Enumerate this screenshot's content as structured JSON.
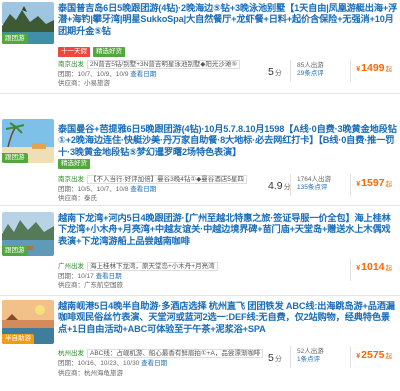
{
  "colors": {
    "title_link": "#1a6db8",
    "price": "#ff6600",
    "tag_red": "#e94a3c",
    "tag_green": "#52a83e",
    "city_green": "#2a8a2a"
  },
  "products": [
    {
      "title": "泰国普吉岛6日5晚跟团游(4钻)·2晚海边⑤钻+3晚泳池别墅【1天自由|凤凰游艇出海+浮潜+海钓|攀牙湾|明星SukkoSpa|大自然餐厅+龙虾餐+日料+起价含保险+无强消+10月团期升金⑤钻",
      "thumb_badge": "跟团游",
      "tags": [
        "十一天假",
        "精选好货"
      ],
      "info_city": "南京出发",
      "info_detail": "2N普吉5钻/别墅+3N普吉明星泳池别墅◆阳光沙滩⑤",
      "info_time": "团期：10/7、10/9、10/9",
      "info_more": "查看日期",
      "supplier": "供应商：小易旅游",
      "score": "5",
      "score_unit": "分",
      "review_count": "85人出游",
      "review_link": "29条点评",
      "price_symbol": "¥",
      "price": "1499",
      "price_suffix": "起"
    },
    {
      "title": "泰国曼谷+芭提雅6日5晚跟团游(4钻)·10月5.7.8.10月1598【A线·0自费·3晚黄金地段钻①+2晚海边连住·快艇沙美·丹万家自助餐·8大地标·必去网红打卡】【B线·0自费·推一罚十·3晚黄金地段钻⑤梦幻暹罗曙2场特色表演】",
      "thumb_badge": "跟团游",
      "tags": [
        "精选好货"
      ],
      "info_city": "南京出发",
      "info_detail": "【不入当行·好评加倍】曼谷3晚4钻①◆曼谷酒店5星四",
      "info_time": "团期：10/5、10/7、10/8",
      "info_more": "查看日期",
      "supplier": "供应商：泰氏",
      "score": "4.9",
      "score_unit": "分",
      "review_count": "1764人出游",
      "review_link": "135条点评",
      "price_symbol": "¥",
      "price": "1597",
      "price_suffix": "起"
    },
    {
      "title": "越南下龙湾+河内5日4晚跟团游·【广州至越北特惠之旅·签证导服一价全包】海上桂林下龙湾+小木舟+月亮湾+中越友谊关·中越边境界碑+苗门庙+天堂岛+赠送水上木偶戏表演+下龙湾游船上品尝越南咖啡",
      "thumb_badge": "跟团游",
      "tags": [],
      "info_city": "广州出发",
      "info_detail": "海上桂林下龙湾，原天堂岛+小木舟+月亮湾",
      "info_time": "团期：10/17",
      "info_more": "查看日期",
      "supplier": "供应商：广东航空国旅",
      "score": "",
      "score_unit": "",
      "review_count": "",
      "review_link": "",
      "price_symbol": "¥",
      "price": "1014",
      "price_suffix": "起"
    },
    {
      "title": "越南岘港5日4晚半自助游·多酒店选择 杭州直飞 团团铁发 ABC线:出海跳岛游+品酒漏咖啡观民俗丝竹表演、天堂河或蓝河2选一:DEF线:无自费，仅2站购物，经典特色景点+1日自由活动+ABC可体验至于午茶+泥浆浴+SPA",
      "thumb_badge": "半自助游",
      "tags": [],
      "info_city": "杭州出发",
      "info_detail": "ABC线：占岘机游、船心最香有鲜眉拍①+A，品尝漂渐咖啡",
      "info_time": "团期：10/16、10/23、10/30",
      "info_more": "查看日期",
      "supplier": "供应商：杭州海龟旅游",
      "score": "5",
      "score_unit": "分",
      "review_count": "52人出游",
      "review_link": "1条点评",
      "price_symbol": "¥",
      "price": "2575",
      "price_suffix": "起"
    }
  ]
}
